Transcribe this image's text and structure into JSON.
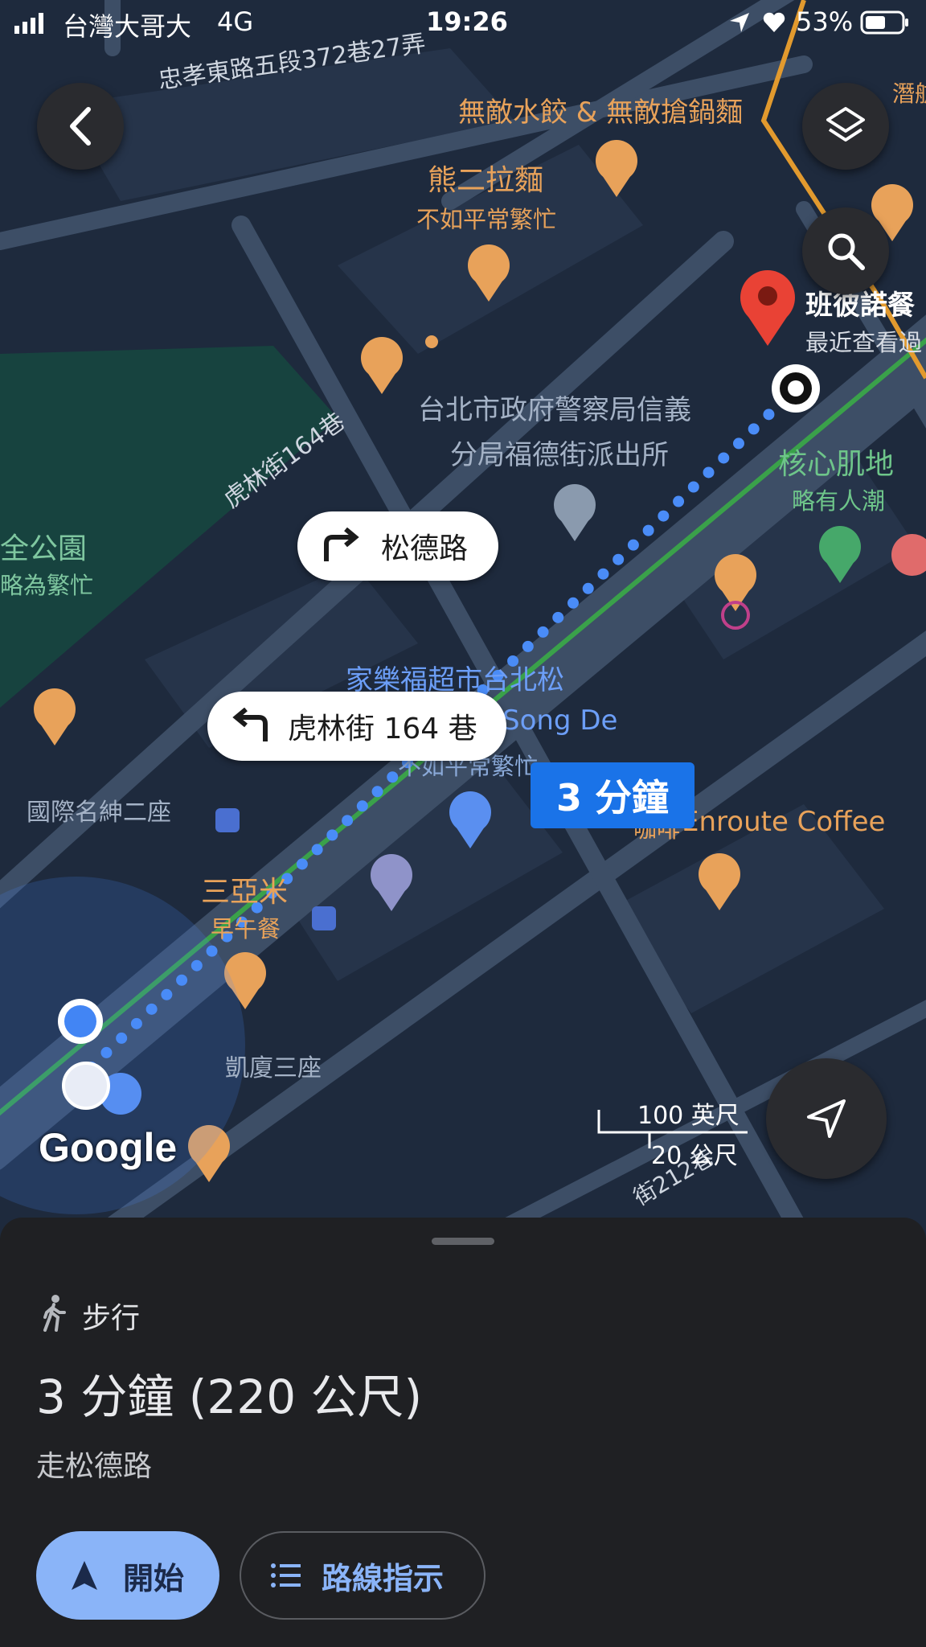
{
  "status_bar": {
    "carrier": "台灣大哥大",
    "network": "4G",
    "time": "19:26",
    "battery": "53%"
  },
  "map": {
    "labels": {
      "street_top": "忠孝東路五段372巷27弄",
      "poi_dumpling": "無敵水餃 & 無敵搶鍋麵",
      "poi_ramen": "熊二拉麵",
      "poi_ramen_sub": "不如平常繁忙",
      "poi_dest": "班彼諾餐",
      "poi_dest_sub": "最近查看過",
      "poi_police_1": "台北市政府警察局信義",
      "poi_police_2": "分局福德街派出所",
      "poi_gym": "核心肌地",
      "poi_gym_sub": "略有人潮",
      "street_hulin": "虎林街164巷",
      "poi_park": "全公園",
      "poi_park_sub": "略為繁忙",
      "poi_carrefour": "家樂福超市台北松",
      "poi_carrefour_en": "Song De",
      "poi_carrefour_sub": "不如平常繁忙",
      "poi_building": "國際名紳二座",
      "poi_sanyami": "三亞米",
      "poi_sanyami_sub": "早午餐",
      "poi_coffee": "Enroute Coffee",
      "poi_coffee_zh": "咖啡",
      "poi_kaisha": "凱廈三座",
      "street_212": "街212巷",
      "poi_right_top": "潛航",
      "google_logo": "Google"
    },
    "turn_bubbles": {
      "right": "松德路",
      "left": "虎林街 164 巷"
    },
    "duration_badge": "3 分鐘",
    "scale": {
      "imperial": "100 英尺",
      "metric": "20 公尺"
    },
    "colors": {
      "accent": "#1a73e8",
      "route": "#4a8cf7",
      "poi_food": "#e8a25a",
      "dest_pin": "#e94235"
    }
  },
  "sheet": {
    "mode_label": "步行",
    "summary": "3 分鐘 (220 公尺)",
    "via": "走松德路",
    "start_button": "開始",
    "steps_button": "路線指示"
  }
}
